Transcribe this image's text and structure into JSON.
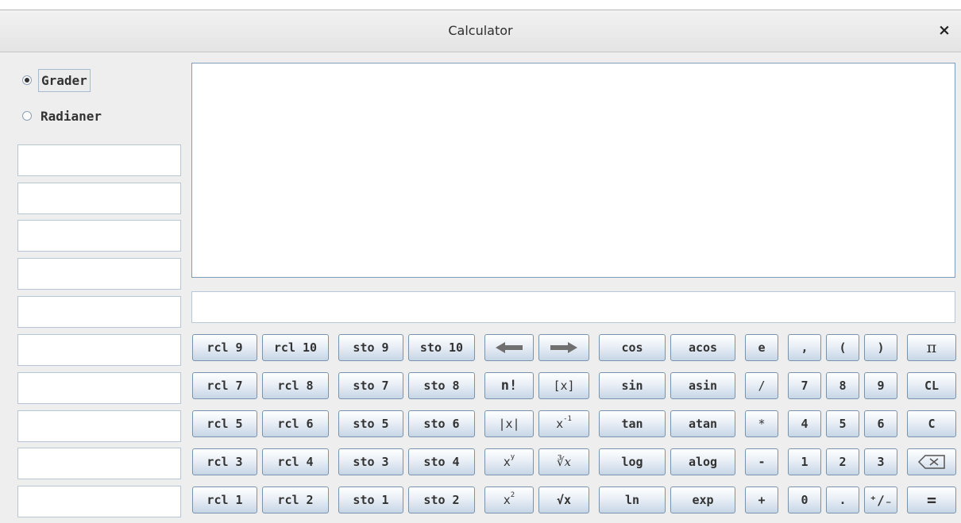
{
  "window": {
    "title": "Calculator",
    "close_label": "×"
  },
  "angle_mode": {
    "options": [
      {
        "label": "Grader",
        "checked": true
      },
      {
        "label": "Radianer",
        "checked": false
      }
    ]
  },
  "memory_fields": [
    "",
    "",
    "",
    "",
    "",
    "",
    "",
    "",
    "",
    ""
  ],
  "display": {
    "value": ""
  },
  "input": {
    "value": ""
  },
  "buttons": {
    "rcl9": "rcl 9",
    "rcl10": "rcl 10",
    "sto9": "sto 9",
    "sto10": "sto 10",
    "cos": "cos",
    "acos": "acos",
    "e": "e",
    "comma": ",",
    "lparen": "(",
    "rparen": ")",
    "pi": "π",
    "rcl7": "rcl 7",
    "rcl8": "rcl 8",
    "sto7": "sto 7",
    "sto8": "sto 8",
    "factorial": "n!",
    "floor": "[x]",
    "sin": "sin",
    "asin": "asin",
    "divide": "/",
    "d7": "7",
    "d8": "8",
    "d9": "9",
    "cl": "CL",
    "rcl5": "rcl 5",
    "rcl6": "rcl 6",
    "sto5": "sto 5",
    "sto6": "sto 6",
    "abs": "|x|",
    "reciprocal_base": "x",
    "reciprocal_exp": "-1",
    "tan": "tan",
    "atan": "atan",
    "multiply": "*",
    "d4": "4",
    "d5": "5",
    "d6": "6",
    "c": "C",
    "rcl3": "rcl 3",
    "rcl4": "rcl 4",
    "sto3": "sto 3",
    "sto4": "sto 4",
    "power_base": "x",
    "power_exp": "y",
    "yroot": "∛x",
    "log": "log",
    "alog": "alog",
    "minus": "-",
    "d1": "1",
    "d2": "2",
    "d3": "3",
    "rcl1": "rcl 1",
    "rcl2": "rcl 2",
    "sto1": "sto 1",
    "sto2": "sto 2",
    "square_base": "x",
    "square_exp": "2",
    "sqrt": "√x",
    "ln": "ln",
    "exp": "exp",
    "plus": "+",
    "d0": "0",
    "dot": ".",
    "plusminus": "⁺∕₋",
    "equals": "="
  },
  "icons": {
    "left": "arrow-left-icon",
    "right": "arrow-right-icon",
    "backspace": "backspace-icon"
  },
  "colors": {
    "button_top": "#ffffff",
    "button_bottom": "#c6d6e6",
    "button_border": "#7a93ad",
    "display_border": "#7f9db9"
  }
}
